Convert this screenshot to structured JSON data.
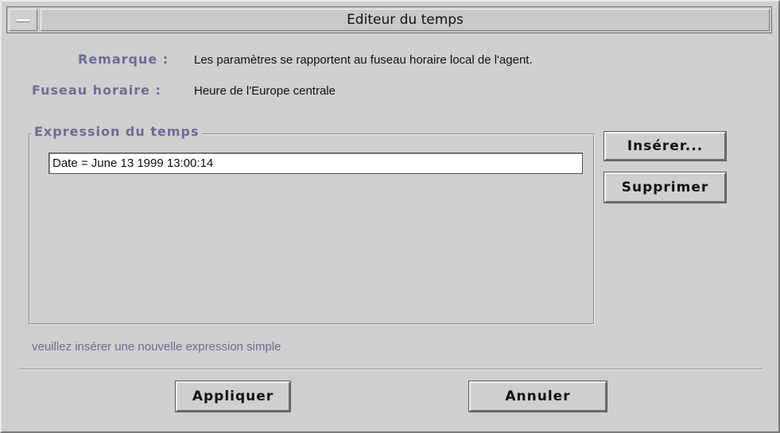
{
  "window": {
    "title": "Editeur du temps"
  },
  "info": {
    "remark_label": "Remarque :",
    "remark_value": "Les paramètres se rapportent au fuseau horaire local de l'agent.",
    "timezone_label": "Fuseau horaire :",
    "timezone_value": "Heure de l'Europe centrale"
  },
  "expression_group": {
    "title": "Expression du temps",
    "items": [
      "Date = June 13 1999 13:00:14"
    ]
  },
  "side_buttons": {
    "insert": "Insérer...",
    "delete": "Supprimer"
  },
  "hint": "veuillez insérer une nouvelle expression simple",
  "footer": {
    "apply": "Appliquer",
    "cancel": "Annuler"
  }
}
